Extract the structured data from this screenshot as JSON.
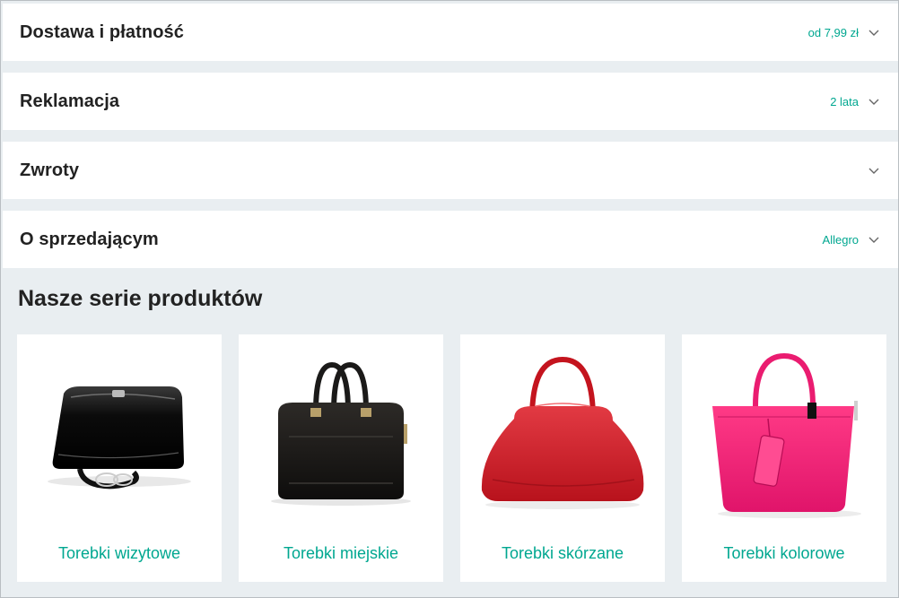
{
  "accordion": [
    {
      "title": "Dostawa i płatność",
      "value": "od 7,99 zł"
    },
    {
      "title": "Reklamacja",
      "value": "2 lata"
    },
    {
      "title": "Zwroty",
      "value": ""
    },
    {
      "title": "O sprzedającym",
      "value": "Allegro"
    }
  ],
  "series": {
    "title": "Nasze serie produktów",
    "products": [
      {
        "label": "Torebki wizytowe",
        "icon": "black-patent-clutch-image"
      },
      {
        "label": "Torebki miejskie",
        "icon": "black-leather-briefcase-image"
      },
      {
        "label": "Torebki skórzane",
        "icon": "red-leather-handbag-image"
      },
      {
        "label": "Torebki kolorowe",
        "icon": "pink-tote-bag-image"
      }
    ]
  },
  "colors": {
    "accent": "#00a790",
    "background": "#e9eef1",
    "panel": "#ffffff",
    "text": "#222222"
  }
}
